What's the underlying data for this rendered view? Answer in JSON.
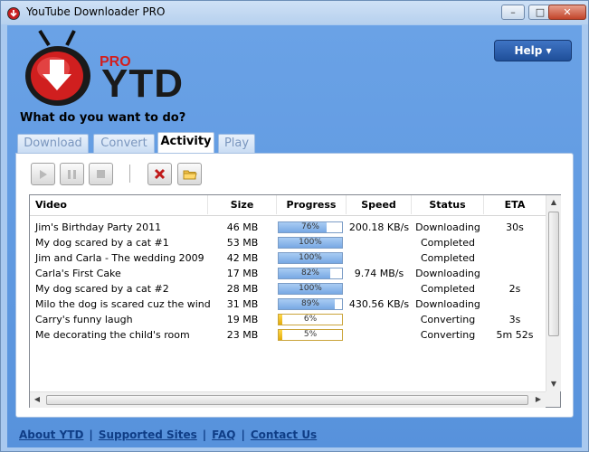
{
  "window": {
    "title": "YouTube Downloader PRO",
    "controls": {
      "minimize": "–",
      "maximize": "□",
      "close": "✕"
    }
  },
  "logo": {
    "pro": "PRO",
    "ytd": "YTD"
  },
  "help_button": {
    "label": "Help ▾"
  },
  "question": "What do you want to do?",
  "tabs": [
    {
      "label": "Download",
      "active": false
    },
    {
      "label": "Convert",
      "active": false
    },
    {
      "label": "Activity",
      "active": true
    },
    {
      "label": "Play",
      "active": false
    }
  ],
  "toolbar": {
    "buttons": [
      "play-icon",
      "pause-icon",
      "stop-icon",
      "cancel-icon",
      "folder-icon"
    ]
  },
  "table": {
    "columns": [
      "Video",
      "Size",
      "Progress",
      "Speed",
      "Status",
      "ETA"
    ],
    "rows": [
      {
        "video": "Jim's Birthday Party 2011",
        "size": "46 MB",
        "progress": 76,
        "progress_label": "76%",
        "speed": "200.18 KB/s",
        "status": "Downloading",
        "eta": "30s",
        "bar": "download"
      },
      {
        "video": "My dog scared by a cat #1",
        "size": "53 MB",
        "progress": 100,
        "progress_label": "100%",
        "speed": "",
        "status": "Completed",
        "eta": "",
        "bar": "download"
      },
      {
        "video": "Jim and Carla - The wedding 2009",
        "size": "42 MB",
        "progress": 100,
        "progress_label": "100%",
        "speed": "",
        "status": "Completed",
        "eta": "",
        "bar": "download"
      },
      {
        "video": "Carla's First Cake",
        "size": "17 MB",
        "progress": 82,
        "progress_label": "82%",
        "speed": "9.74 MB/s",
        "status": "Downloading",
        "eta": "",
        "bar": "download"
      },
      {
        "video": "My dog scared by a cat #2",
        "size": "28 MB",
        "progress": 100,
        "progress_label": "100%",
        "speed": "",
        "status": "Completed",
        "eta": "2s",
        "bar": "download"
      },
      {
        "video": "Milo the dog is scared cuz the wind",
        "size": "31 MB",
        "progress": 89,
        "progress_label": "89%",
        "speed": "430.56 KB/s",
        "status": "Downloading",
        "eta": "",
        "bar": "download"
      },
      {
        "video": "Carry's funny laugh",
        "size": "19 MB",
        "progress": 6,
        "progress_label": "6%",
        "speed": "",
        "status": "Converting",
        "eta": "3s",
        "bar": "convert"
      },
      {
        "video": "Me decorating the child's room",
        "size": "23 MB",
        "progress": 5,
        "progress_label": "5%",
        "speed": "",
        "status": "Converting",
        "eta": "5m 52s",
        "bar": "convert"
      }
    ]
  },
  "footer": {
    "links": [
      "About YTD",
      "Supported Sites",
      "FAQ",
      "Contact Us"
    ],
    "separator": "|"
  },
  "colors": {
    "accent": "#5792dc",
    "progress_download": "#78a8e4",
    "progress_convert": "#e2ab0a",
    "link": "#0f3d86"
  }
}
